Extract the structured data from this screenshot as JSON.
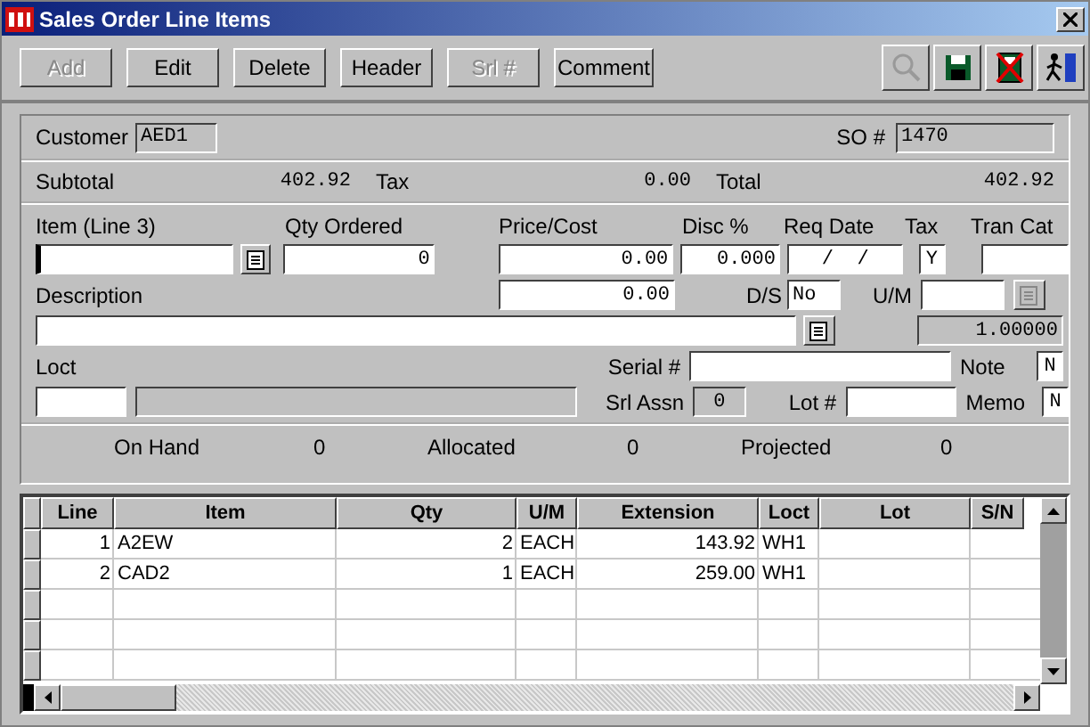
{
  "window": {
    "title": "Sales Order Line Items"
  },
  "toolbar": {
    "buttons": [
      {
        "label": "Add",
        "disabled": true
      },
      {
        "label": "Edit",
        "disabled": false
      },
      {
        "label": "Delete",
        "disabled": false
      },
      {
        "label": "Header",
        "disabled": false
      },
      {
        "label": "Srl #",
        "disabled": true
      },
      {
        "label": "Comment",
        "disabled": false
      }
    ],
    "icons": [
      {
        "kind": "search",
        "disabled": true
      },
      {
        "kind": "save",
        "disabled": false
      },
      {
        "kind": "cancel",
        "disabled": false
      },
      {
        "kind": "exit",
        "disabled": false
      }
    ]
  },
  "header": {
    "customer_label": "Customer",
    "customer": "AED1",
    "so_label": "SO #",
    "so": "1470"
  },
  "totals": [
    {
      "label": "Subtotal",
      "value": "402.92"
    },
    {
      "label": "Tax",
      "value": "0.00"
    },
    {
      "label": "Total",
      "value": "402.92"
    }
  ],
  "line_entry": {
    "item_label": "Item  (Line 3)",
    "qty_label": "Qty Ordered",
    "qty": "0",
    "price_label": "Price/Cost",
    "price": "0.00",
    "disc_label": "Disc %",
    "disc": "0.000",
    "req_date_label": "Req Date",
    "req_date": "/  /",
    "tax_label": "Tax",
    "tax": "Y",
    "tran_cat_label": "Tran Cat",
    "description_label": "Description",
    "cost": "0.00",
    "ds_label": "D/S",
    "ds": "No",
    "um_label": "U/M",
    "um_lookup_disabled": true,
    "um_factor": "1.00000",
    "loct_label": "Loct",
    "serial_label": "Serial #",
    "note_label": "Note",
    "note": "N",
    "srl_assn_label": "Srl Assn",
    "srl_assn": "0",
    "lot_label": "Lot #",
    "memo_label": "Memo",
    "memo": "N"
  },
  "stock": [
    {
      "label": "On Hand",
      "value": "0"
    },
    {
      "label": "Allocated",
      "value": "0"
    },
    {
      "label": "Projected",
      "value": "0"
    }
  ],
  "table": {
    "columns": [
      "Line",
      "Item",
      "Qty",
      "U/M",
      "Extension",
      "Loct",
      "Lot",
      "S/N"
    ],
    "rows": [
      [
        "1",
        "A2EW",
        "2",
        "EACH",
        "143.92",
        "WH1"
      ],
      [
        "2",
        "CAD2",
        "1",
        "EACH",
        "259.00",
        "WH1"
      ]
    ]
  }
}
